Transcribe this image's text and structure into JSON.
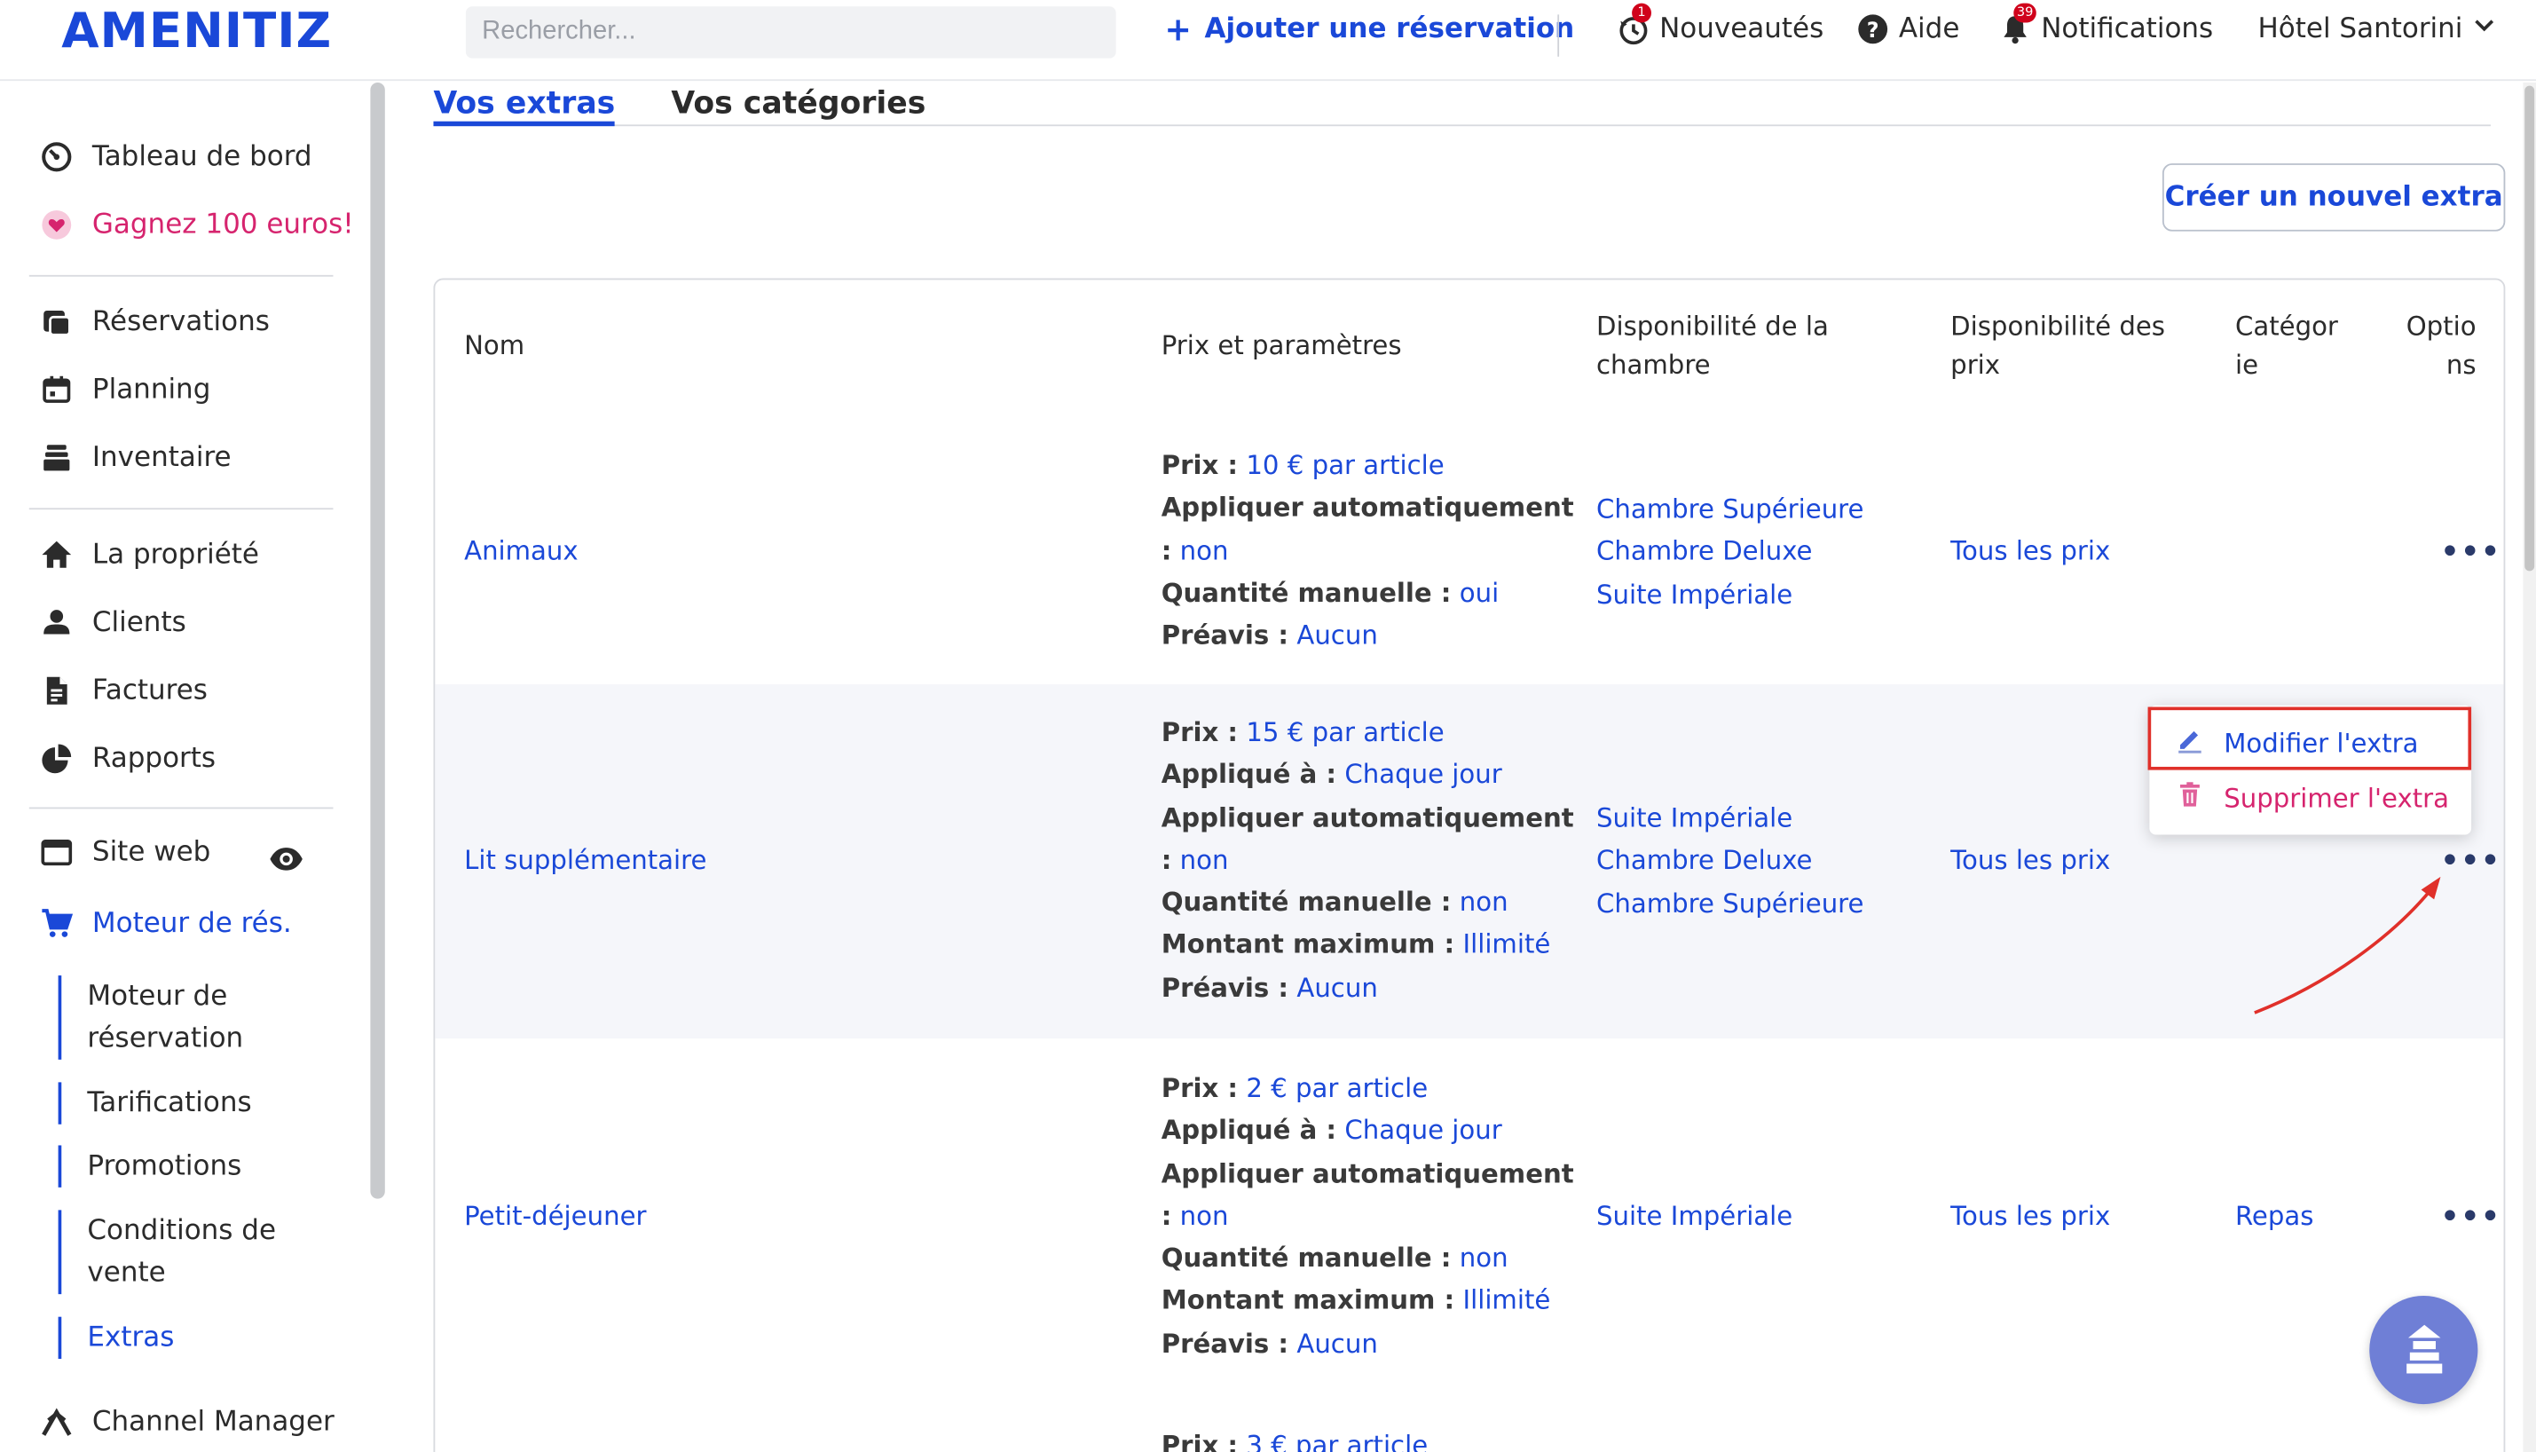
{
  "header": {
    "logo": "AMENITIZ",
    "search_placeholder": "Rechercher...",
    "add_reservation": "Ajouter une réservation",
    "news": "Nouveautés",
    "news_badge": "1",
    "help": "Aide",
    "notifications": "Notifications",
    "notifications_badge": "39",
    "hotel": "Hôtel Santorini"
  },
  "sidebar": {
    "dashboard": "Tableau de bord",
    "referral": "Gagnez 100 euros!",
    "reservations": "Réservations",
    "planning": "Planning",
    "inventory": "Inventaire",
    "property": "La propriété",
    "clients": "Clients",
    "invoices": "Factures",
    "reports": "Rapports",
    "website": "Site web",
    "booking_engine": "Moteur de rés.",
    "sub": {
      "engine_line1": "Moteur de",
      "engine_line2": "réservation",
      "rates": "Tarifications",
      "promotions": "Promotions",
      "conditions_line1": "Conditions de",
      "conditions_line2": "vente",
      "extras": "Extras"
    },
    "channel_manager": "Channel Manager"
  },
  "tabs": {
    "extras": "Vos extras",
    "categories": "Vos catégories"
  },
  "create_button": "Créer un nouvel extra",
  "table": {
    "headers": {
      "name": "Nom",
      "price": "Prix et paramètres",
      "room_avail_1": "Disponibilité de la",
      "room_avail_2": "chambre",
      "price_avail_1": "Disponibilité des",
      "price_avail_2": "prix",
      "category_1": "Catégor",
      "category_2": "ie",
      "options_1": "Optio",
      "options_2": "ns"
    },
    "labels": {
      "price": "Prix :",
      "applied": "Appliqué à :",
      "auto": "Appliquer automatiquement",
      "colon": ":",
      "manual": "Quantité manuelle :",
      "max": "Montant maximum :",
      "notice": "Préavis :"
    },
    "rows": [
      {
        "name": "Animaux",
        "price": "10 € par article",
        "auto": "non",
        "manual": "oui",
        "notice": "Aucun",
        "rooms": [
          "Chambre Supérieure",
          "Chambre Deluxe",
          "Suite Impériale"
        ],
        "price_avail": "Tous les prix",
        "category": "",
        "options": "•••"
      },
      {
        "name": "Lit supplémentaire",
        "price": "15 € par article",
        "applied": "Chaque jour",
        "auto": "non",
        "manual": "non",
        "max": "Illimité",
        "notice": "Aucun",
        "rooms": [
          "Suite Impériale",
          "Chambre Deluxe",
          "Chambre Supérieure"
        ],
        "price_avail": "Tous les prix",
        "category": "",
        "options": "•••"
      },
      {
        "name": "Petit-déjeuner",
        "price": "2 € par article",
        "applied": "Chaque jour",
        "auto": "non",
        "manual": "non",
        "max": "Illimité",
        "notice": "Aucun",
        "rooms": [
          "Suite Impériale"
        ],
        "price_avail": "Tous les prix",
        "category": "Repas",
        "options": "•••"
      },
      {
        "price": "3 € par article"
      }
    ]
  },
  "context_menu": {
    "edit": "Modifier l'extra",
    "delete": "Supprimer l'extra"
  },
  "colors": {
    "brand": "#1a48d8",
    "pink": "#d6246e",
    "highlight": "#e0302a"
  }
}
